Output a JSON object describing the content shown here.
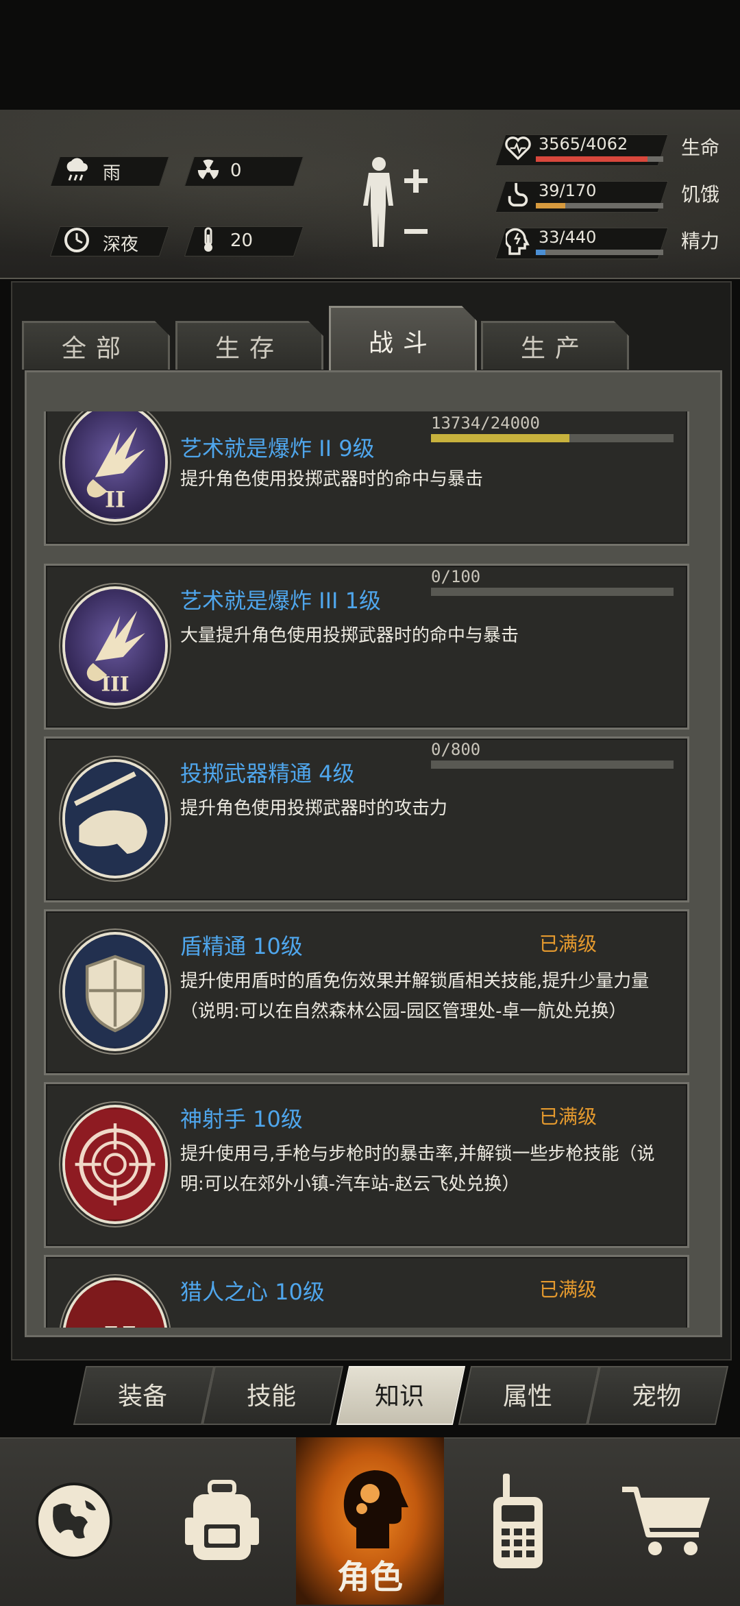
{
  "status": {
    "weather": {
      "icon": "rain-cloud-icon",
      "label": "雨"
    },
    "radiation": {
      "icon": "radiation-icon",
      "value": "0"
    },
    "time": {
      "icon": "clock-icon",
      "label": "深夜"
    },
    "temperature": {
      "icon": "thermometer-icon",
      "value": "20"
    },
    "body_icon": "body-figure-icon",
    "life": {
      "value": "3565/4062",
      "label": "生命",
      "fill": 0.878,
      "color": "#d8473c"
    },
    "hunger": {
      "value": "39/170",
      "label": "饥饿",
      "fill": 0.229,
      "color": "#d79a3e"
    },
    "energy": {
      "value": "33/440",
      "label": "精力",
      "fill": 0.075,
      "color": "#4b8fd4"
    }
  },
  "category_tabs": [
    "全部",
    "生存",
    "战斗",
    "生产"
  ],
  "active_category": 2,
  "skills": [
    {
      "title": "艺术就是爆炸 II 9级",
      "desc": "提升角色使用投掷武器时的命中与暴击",
      "progress_text": "13734/24000",
      "progress": 0.572,
      "maxed_label": "",
      "icon": "explosion-ii-icon"
    },
    {
      "title": "艺术就是爆炸 III 1级",
      "desc": "大量提升角色使用投掷武器时的命中与暴击",
      "progress_text": "0/100",
      "progress": 0,
      "maxed_label": "",
      "icon": "explosion-iii-icon"
    },
    {
      "title": "投掷武器精通 4级",
      "desc": "提升角色使用投掷武器时的攻击力",
      "progress_text": "0/800",
      "progress": 0,
      "maxed_label": "",
      "icon": "throwing-arm-icon"
    },
    {
      "title": "盾精通 10级",
      "desc": "提升使用盾时的盾免伤效果并解锁盾相关技能,提升少量力量（说明:可以在自然森林公园-园区管理处-卓一航处兑换）",
      "progress_text": "",
      "progress": null,
      "maxed_label": "已满级",
      "icon": "shield-icon"
    },
    {
      "title": "神射手 10级",
      "desc": "提升使用弓,手枪与步枪时的暴击率,并解锁一些步枪技能（说明:可以在郊外小镇-汽车站-赵云飞处兑换）",
      "progress_text": "",
      "progress": null,
      "maxed_label": "已满级",
      "icon": "crosshair-icon"
    },
    {
      "title": "猎人之心 10级",
      "desc": "",
      "progress_text": "",
      "progress": null,
      "maxed_label": "已满级",
      "icon": "claw-icon"
    }
  ],
  "sub_tabs": [
    "装备",
    "技能",
    "知识",
    "属性",
    "宠物"
  ],
  "active_sub_tab": 2,
  "bottom_nav": [
    {
      "icon": "globe-icon",
      "label": ""
    },
    {
      "icon": "backpack-icon",
      "label": ""
    },
    {
      "icon": "character-head-icon",
      "label": "角色"
    },
    {
      "icon": "walkie-talkie-icon",
      "label": ""
    },
    {
      "icon": "shopping-cart-icon",
      "label": ""
    }
  ],
  "active_nav": 2
}
